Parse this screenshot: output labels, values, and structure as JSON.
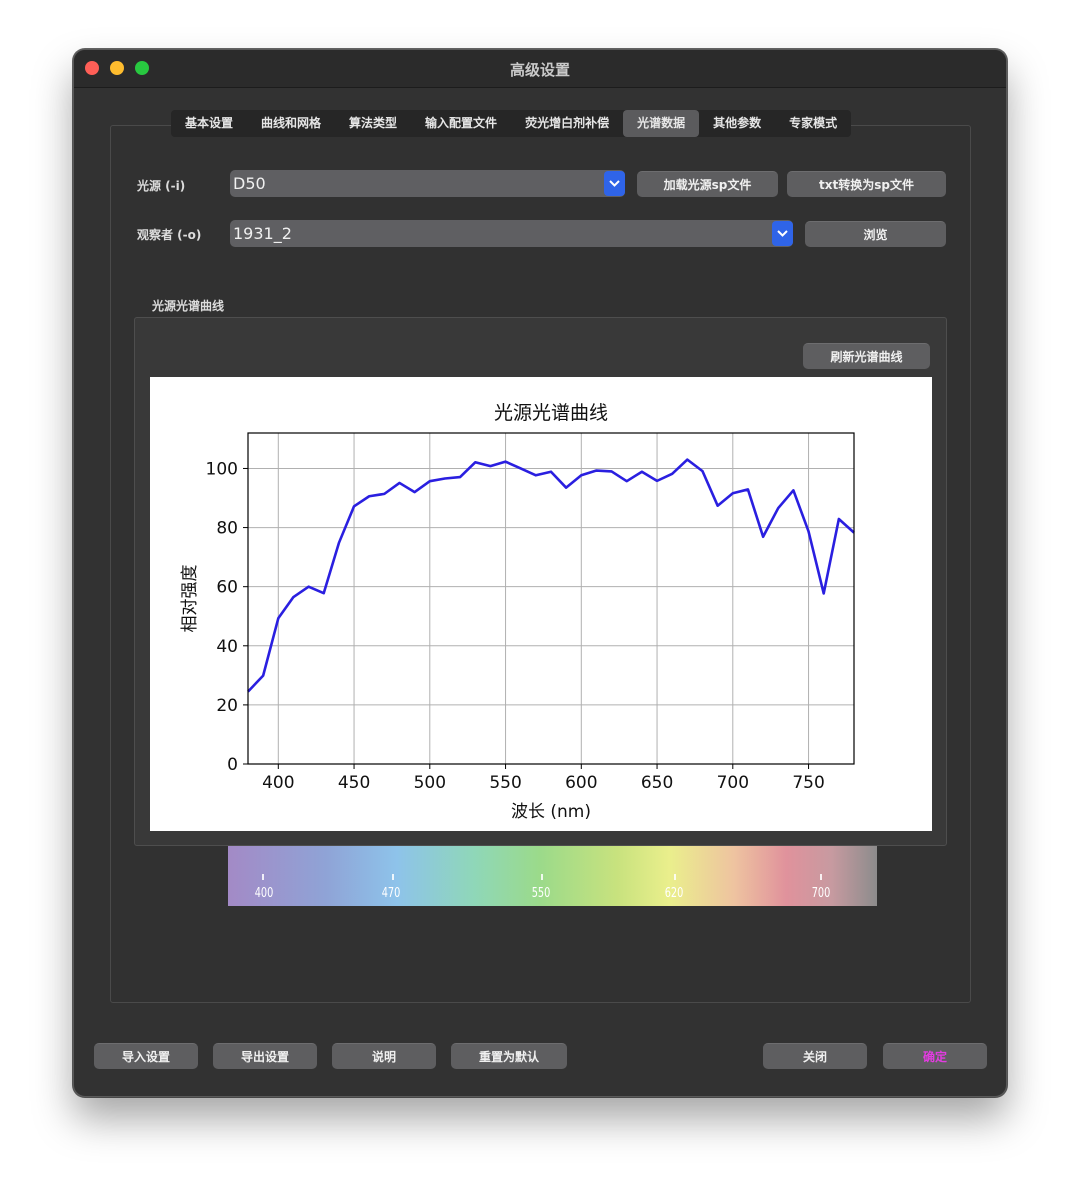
{
  "window": {
    "title": "高级设置"
  },
  "tabs": [
    {
      "label": "基本设置"
    },
    {
      "label": "曲线和网格"
    },
    {
      "label": "算法类型"
    },
    {
      "label": "输入配置文件"
    },
    {
      "label": "荧光增白剂补偿"
    },
    {
      "label": "光谱数据",
      "active": true
    },
    {
      "label": "其他参数"
    },
    {
      "label": "专家模式"
    }
  ],
  "illuminant": {
    "label": "光源 (-i)",
    "value": "D50",
    "load_button": "加载光源sp文件",
    "convert_button": "txt转换为sp文件"
  },
  "observer": {
    "label": "观察者 (-o)",
    "value": "1931_2",
    "browse_button": "浏览"
  },
  "curve_group": {
    "title": "光源光谱曲线",
    "refresh_button": "刷新光谱曲线"
  },
  "chart_data": {
    "type": "line",
    "title": "光源光谱曲线",
    "xlabel": "波长 (nm)",
    "ylabel": "相对强度",
    "xlim": [
      380,
      780
    ],
    "ylim": [
      0,
      112
    ],
    "xticks": [
      400,
      450,
      500,
      550,
      600,
      650,
      700,
      750
    ],
    "yticks": [
      0,
      20,
      40,
      60,
      80,
      100
    ],
    "grid": true,
    "line_color": "#2a1fe0",
    "series": [
      {
        "x": [
          380,
          390,
          400,
          410,
          420,
          430,
          440,
          450,
          460,
          470,
          480,
          490,
          500,
          510,
          520,
          530,
          540,
          550,
          560,
          570,
          580,
          590,
          600,
          610,
          620,
          630,
          640,
          650,
          660,
          670,
          680,
          690,
          700,
          710,
          720,
          730,
          740,
          750,
          760,
          770,
          780
        ],
        "values": [
          24.5,
          29.9,
          49.3,
          56.5,
          60.0,
          57.8,
          74.8,
          87.2,
          90.6,
          91.4,
          95.1,
          92.0,
          95.7,
          96.6,
          97.1,
          102.1,
          100.8,
          102.3,
          100.0,
          97.7,
          98.9,
          93.5,
          97.7,
          99.3,
          99.0,
          95.7,
          98.9,
          95.8,
          98.2,
          103.0,
          99.1,
          87.4,
          91.6,
          92.9,
          76.9,
          86.6,
          92.6,
          78.7,
          57.7,
          82.9,
          78.3
        ]
      }
    ]
  },
  "spectrum_bar": {
    "labels": [
      "400",
      "470",
      "550",
      "620",
      "700"
    ]
  },
  "footer": {
    "import": "导入设置",
    "export": "导出设置",
    "help": "说明",
    "reset": "重置为默认",
    "close": "关闭",
    "ok": "确定"
  }
}
